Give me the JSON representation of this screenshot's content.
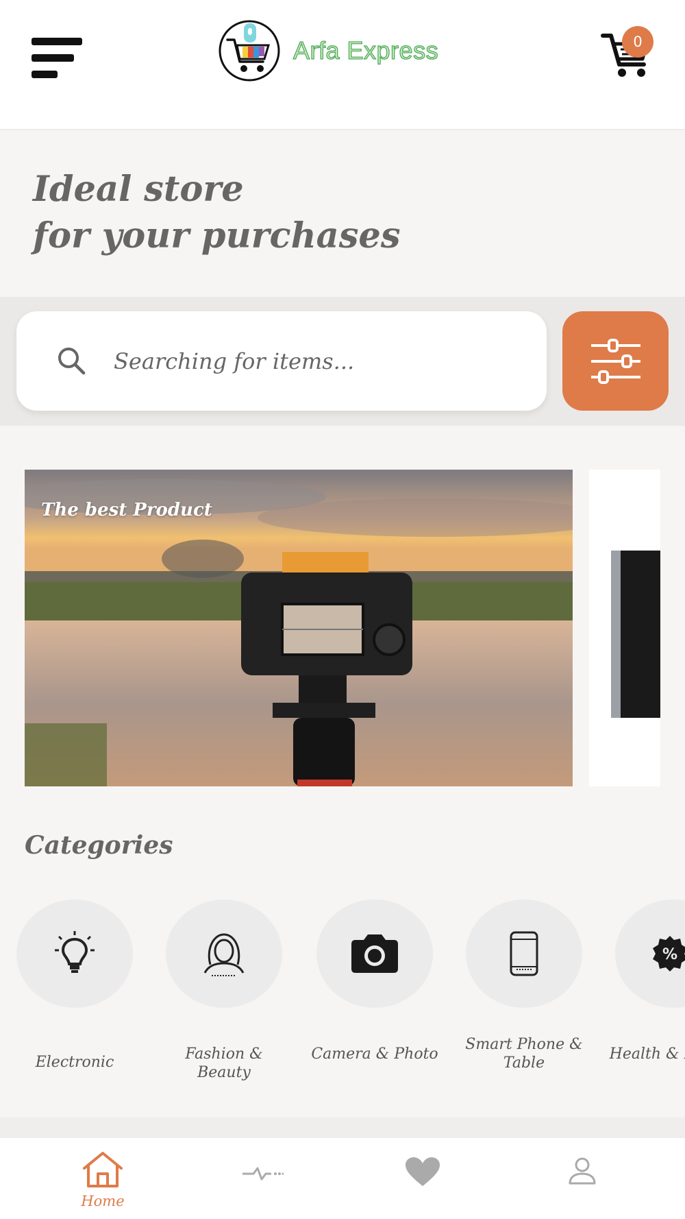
{
  "header": {
    "app_name": "Arfa Express",
    "cart_count": "0",
    "accent_color": "#de7b49",
    "brand_color": "#52a95a"
  },
  "hero": {
    "line1": "Ideal store",
    "line2": "for your purchases"
  },
  "search": {
    "placeholder": "Searching for items...",
    "value": ""
  },
  "banner": {
    "caption": "The best Product"
  },
  "categories": {
    "heading": "Categories",
    "items": [
      {
        "label": "Electronic",
        "icon": "lightbulb-icon"
      },
      {
        "label": "Fashion & Beauty",
        "icon": "woman-face-icon"
      },
      {
        "label": "Camera & Photo",
        "icon": "camera-icon"
      },
      {
        "label": "Smart Phone & Table",
        "icon": "smartphone-icon"
      },
      {
        "label": "Health & Beauty",
        "icon": "discount-badge-icon"
      }
    ]
  },
  "bottom_nav": {
    "items": [
      {
        "label": "Home",
        "icon": "home-icon",
        "active": true
      },
      {
        "label": "",
        "icon": "activity-icon",
        "active": false
      },
      {
        "label": "",
        "icon": "heart-icon",
        "active": false
      },
      {
        "label": "",
        "icon": "user-icon",
        "active": false
      }
    ]
  }
}
